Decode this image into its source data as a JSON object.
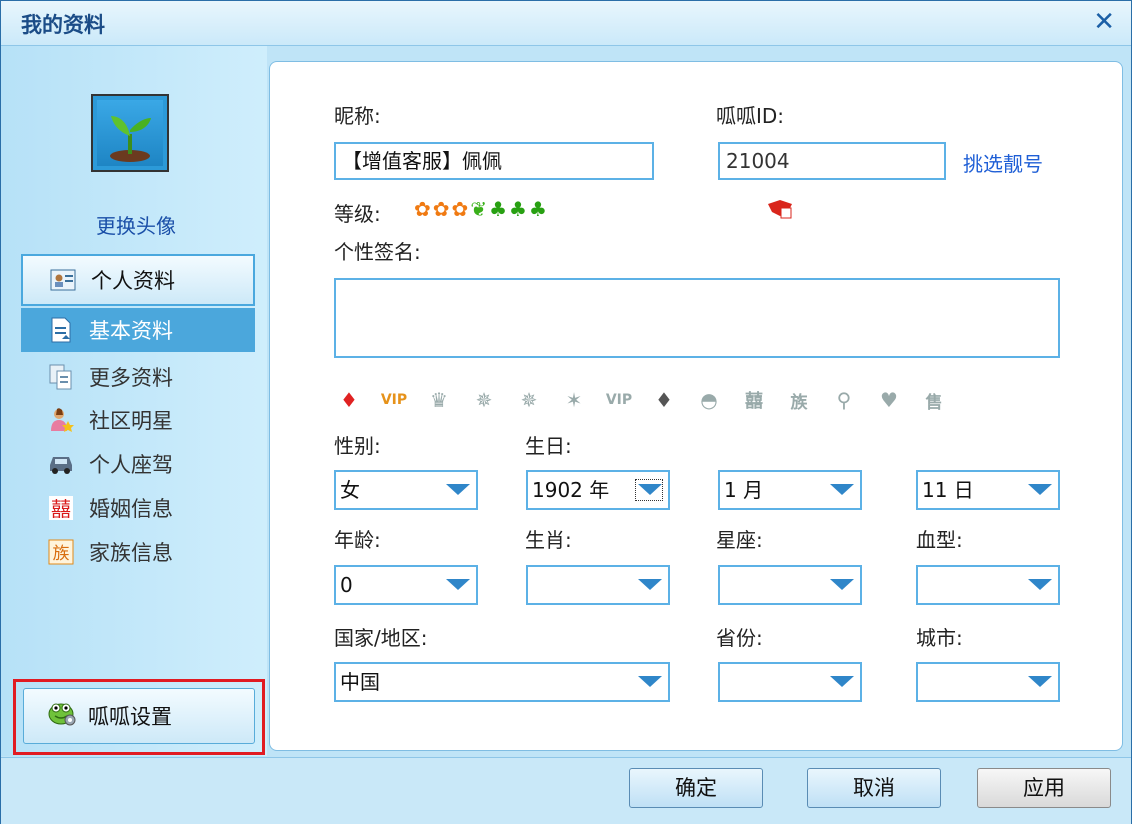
{
  "window": {
    "title": "我的资料",
    "close_glyph": "✕"
  },
  "sidebar": {
    "change_avatar": "更换头像",
    "items": [
      {
        "label": "个人资料",
        "icon": "id-card-icon"
      },
      {
        "label": "基本资料",
        "icon": "document-icon"
      },
      {
        "label": "更多资料",
        "icon": "documents-icon"
      },
      {
        "label": "社区明星",
        "icon": "star-person-icon"
      },
      {
        "label": "个人座驾",
        "icon": "car-icon"
      },
      {
        "label": "婚姻信息",
        "icon": "marriage-icon"
      },
      {
        "label": "家族信息",
        "icon": "family-icon"
      }
    ],
    "settings_label": "呱呱设置"
  },
  "form": {
    "nickname_label": "昵称:",
    "nickname_value": "【增值客服】佩佩",
    "id_label": "呱呱ID:",
    "id_value": "21004",
    "pick_number_link": "挑选靓号",
    "level_label": "等级:",
    "signature_label": "个性签名:",
    "signature_value": "",
    "gender_label": "性别:",
    "gender_value": "女",
    "birthday_label": "生日:",
    "birth_year": "1902 年",
    "birth_month": "1 月",
    "birth_day": "11 日",
    "age_label": "年龄:",
    "age_value": "0",
    "zodiac_label": "生肖:",
    "zodiac_value": "",
    "constellation_label": "星座:",
    "constellation_value": "",
    "blood_label": "血型:",
    "blood_value": "",
    "country_label": "国家/地区:",
    "country_value": "中国",
    "province_label": "省份:",
    "province_value": "",
    "city_label": "城市:",
    "city_value": ""
  },
  "buttons": {
    "ok": "确定",
    "cancel": "取消",
    "apply": "应用"
  },
  "colors": {
    "accent": "#4ba7dc",
    "link": "#1f5fd6",
    "highlight_border": "#e11b22"
  }
}
